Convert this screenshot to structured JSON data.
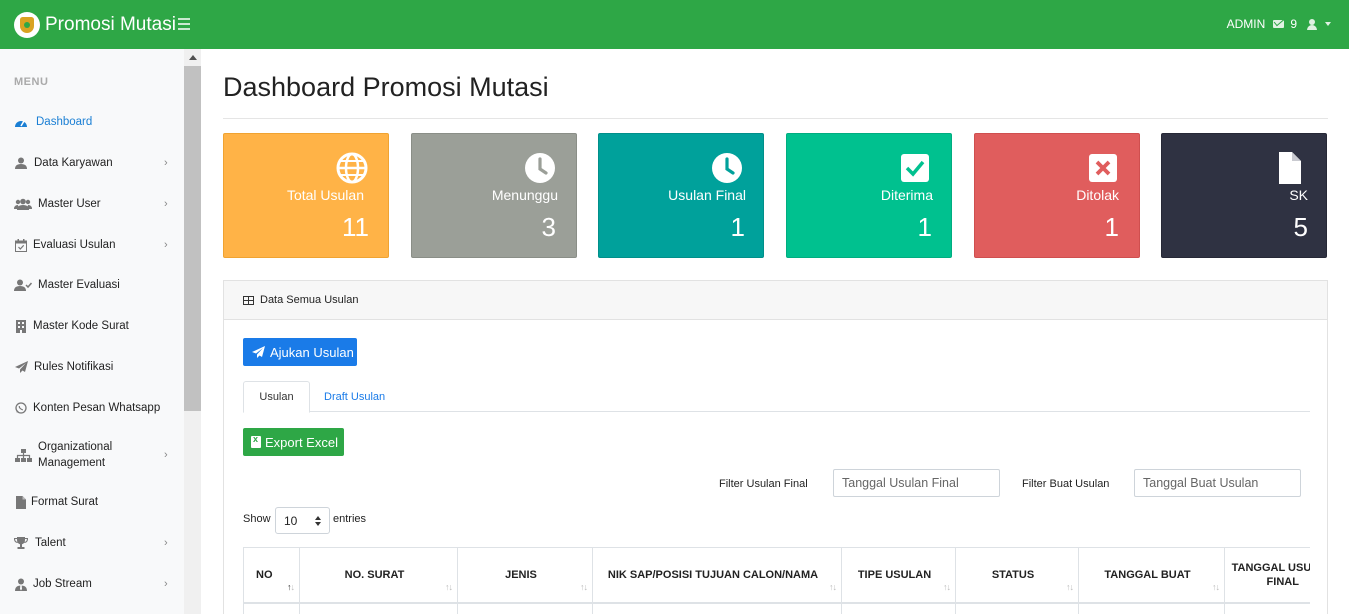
{
  "app": {
    "title": "Promosi Mutasi",
    "user": "ADMIN",
    "notifications": "9"
  },
  "sidebar": {
    "heading": "MENU",
    "items": [
      {
        "label": "Dashboard",
        "icon": "dashboard-icon",
        "active": true,
        "chevron": false
      },
      {
        "label": "Data Karyawan",
        "icon": "user-icon",
        "chevron": true
      },
      {
        "label": "Master User",
        "icon": "users-icon",
        "chevron": true
      },
      {
        "label": "Evaluasi Usulan",
        "icon": "calendar-check-icon",
        "chevron": true
      },
      {
        "label": "Master Evaluasi",
        "icon": "user-check-icon",
        "chevron": false
      },
      {
        "label": "Master Kode Surat",
        "icon": "building-icon",
        "chevron": false
      },
      {
        "label": "Rules Notifikasi",
        "icon": "paper-plane-icon",
        "chevron": false
      },
      {
        "label": "Konten Pesan Whatsapp",
        "icon": "whatsapp-icon",
        "chevron": false
      },
      {
        "label": "Organizational Management",
        "icon": "sitemap-icon",
        "chevron": true
      },
      {
        "label": "Format Surat",
        "icon": "file-icon",
        "chevron": false
      },
      {
        "label": "Talent",
        "icon": "trophy-icon",
        "chevron": true
      },
      {
        "label": "Job Stream",
        "icon": "user-tie-icon",
        "chevron": true
      }
    ],
    "chevron": "›"
  },
  "page": {
    "title": "Dashboard Promosi Mutasi"
  },
  "stats": [
    {
      "label": "Total Usulan",
      "value": "11",
      "color": "#ffb347",
      "icon": "globe-icon"
    },
    {
      "label": "Menunggu",
      "value": "3",
      "color": "#9b9f98",
      "icon": "clock-icon"
    },
    {
      "label": "Usulan Final",
      "value": "1",
      "color": "#00a19b",
      "icon": "clock-icon"
    },
    {
      "label": "Diterima",
      "value": "1",
      "color": "#00c18f",
      "icon": "check-square-icon"
    },
    {
      "label": "Ditolak",
      "value": "1",
      "color": "#e05d5d",
      "icon": "x-square-icon"
    },
    {
      "label": "SK",
      "value": "5",
      "color": "#2f3242",
      "icon": "file-icon"
    }
  ],
  "card": {
    "title": "Data Semua Usulan",
    "ajukan_label": "Ajukan Usulan",
    "tabs": [
      "Usulan",
      "Draft Usulan"
    ],
    "export_label": "Export Excel",
    "filter_final_label": "Filter Usulan Final",
    "filter_final_placeholder": "Tanggal Usulan Final",
    "filter_buat_label": "Filter Buat Usulan",
    "filter_buat_placeholder": "Tanggal Buat Usulan",
    "show_label": "Show",
    "entries_value": "10",
    "entries_label": "entries",
    "columns": [
      "NO",
      "NO. SURAT",
      "JENIS",
      "NIK SAP/POSISI TUJUAN CALON/NAMA",
      "TIPE USULAN",
      "STATUS",
      "TANGGAL BUAT",
      "TANGGAL USULAN FINAL"
    ]
  }
}
